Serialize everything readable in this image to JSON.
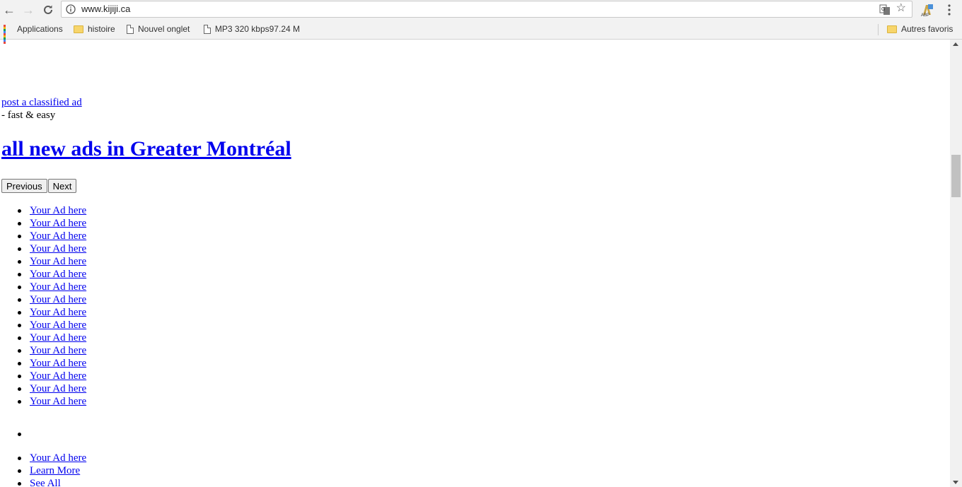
{
  "browser": {
    "url": "www.kijiji.ca",
    "bookmarks": [
      {
        "label": "Applications",
        "icon": "apps-grid-icon"
      },
      {
        "label": "histoire",
        "icon": "folder-icon"
      },
      {
        "label": "Nouvel onglet",
        "icon": "page-icon"
      },
      {
        "label": "MP3 320 kbps97.24 M",
        "icon": "page-icon"
      }
    ],
    "other_bookmarks": "Autres favoris"
  },
  "page": {
    "post_ad_link": "post a classified ad",
    "post_ad_suffix": "- fast & easy",
    "heading": "all new ads in Greater Montréal",
    "pager": {
      "previous": "Previous",
      "next": "Next"
    },
    "ads": [
      "Your Ad here",
      "Your Ad here",
      "Your Ad here",
      "Your Ad here",
      "Your Ad here",
      "Your Ad here",
      "Your Ad here",
      "Your Ad here",
      "Your Ad here",
      "Your Ad here",
      "Your Ad here",
      "Your Ad here",
      "Your Ad here",
      "Your Ad here",
      "Your Ad here",
      "Your Ad here"
    ],
    "footer_items": [
      "Your Ad here",
      "Learn More",
      "See All"
    ]
  },
  "colors": {
    "link": "#0000ee",
    "chrome_bg": "#f2f2f2"
  }
}
